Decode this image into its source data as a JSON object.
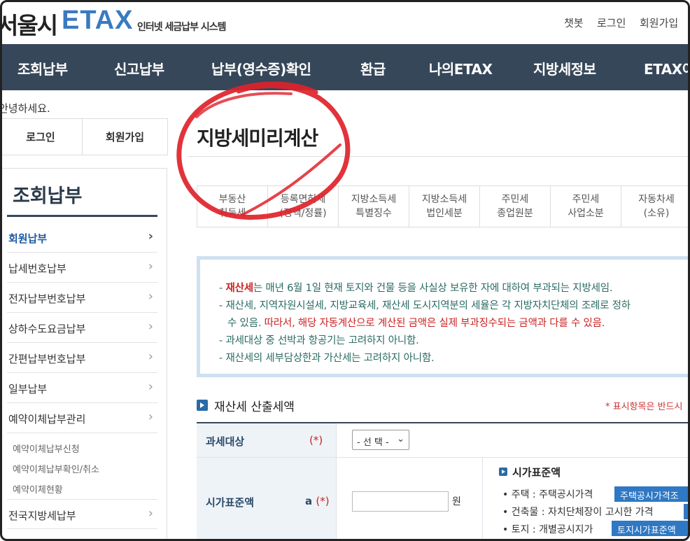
{
  "header": {
    "logo_kr": "서울시",
    "logo_en": "ETAX",
    "logo_sub": "인터넷 세금납부 시스템",
    "util_links": [
      "챗봇",
      "로그인",
      "회원가입"
    ]
  },
  "gnb": [
    "조회납부",
    "신고납부",
    "납부(영수증)확인",
    "환급",
    "나의ETAX",
    "지방세정보",
    "ETAX이"
  ],
  "sidebar": {
    "greeting": "안녕하세요.",
    "login_label": "로그인",
    "join_label": "회원가입",
    "title": "조회납부",
    "chevron": "›",
    "items": [
      "회원납부",
      "납세번호납부",
      "전자납부번호납부",
      "상하수도요금납부",
      "간편납부번호납부",
      "일부납부",
      "예약이체납부관리"
    ],
    "sub_items": [
      "예약이체납부신청",
      "예약이체납부확인/취소",
      "예약이체현황"
    ],
    "items_after": [
      "전국지방세납부"
    ]
  },
  "main": {
    "page_title": "지방세미리계산",
    "tabs": [
      {
        "line1": "부동산",
        "line2": "취득세"
      },
      {
        "line1": "등록면허세",
        "line2": "(정액/정률)"
      },
      {
        "line1": "지방소득세",
        "line2": "특별징수"
      },
      {
        "line1": "지방소득세",
        "line2": "법인세분"
      },
      {
        "line1": "주민세",
        "line2": "종업원분"
      },
      {
        "line1": "주민세",
        "line2": "사업소분"
      },
      {
        "line1": "자동차세",
        "line2": "(소유)"
      }
    ],
    "notice": {
      "l1_pre": "- ",
      "l1_red": "재산세",
      "l1_post": "는 매년 6월 1일 현재 토지와 건물 등을 사실상 보유한 자에 대하여 부과되는 지방세임.",
      "l2": "- 재산세, 지역자원시설세, 지방교육세, 재산세 도시지역분의 세율은 각 지방자치단체의 조례로 정하",
      "l3_pre": "수 있음. ",
      "l3_red": "따라서, 해당 자동계산으로 계산된 금액은 실제 부과징수되는 금액과 다를 수 있음.",
      "l4": "- 과세대상 중 선박과 항공기는 고려하지 아니함.",
      "l5": "- 재산세의 세부담상한과 가산세는 고려하지 아니함."
    },
    "section_title": "재산세 산출세액",
    "required_note": "* 표시항목은 반드시",
    "form": {
      "row1_label": "과세대상",
      "row1_mark": "(*)",
      "row1_select": "- 선 택 -",
      "row2_label": "시가표준액",
      "row2_mark_prefix": "a ",
      "row2_mark": "(*)",
      "row2_value": "",
      "row2_unit": "원",
      "std_title": "시가표준액",
      "std_lines": [
        {
          "text": "• 주택 : 주택공시가격",
          "button": "주택공시가격조"
        },
        {
          "text": "• 건축물 : 자치단체장이 고시한 가격",
          "button": ""
        },
        {
          "text": "• 토지 : 개별공시지가",
          "button": "토지시가표준액"
        }
      ]
    }
  },
  "colors": {
    "gnb_bg": "#37475a",
    "brand_blue": "#3a7ac0",
    "notice_border": "#cfe0f0",
    "required_red": "#cc2222",
    "annotation_red": "#e0222a"
  }
}
